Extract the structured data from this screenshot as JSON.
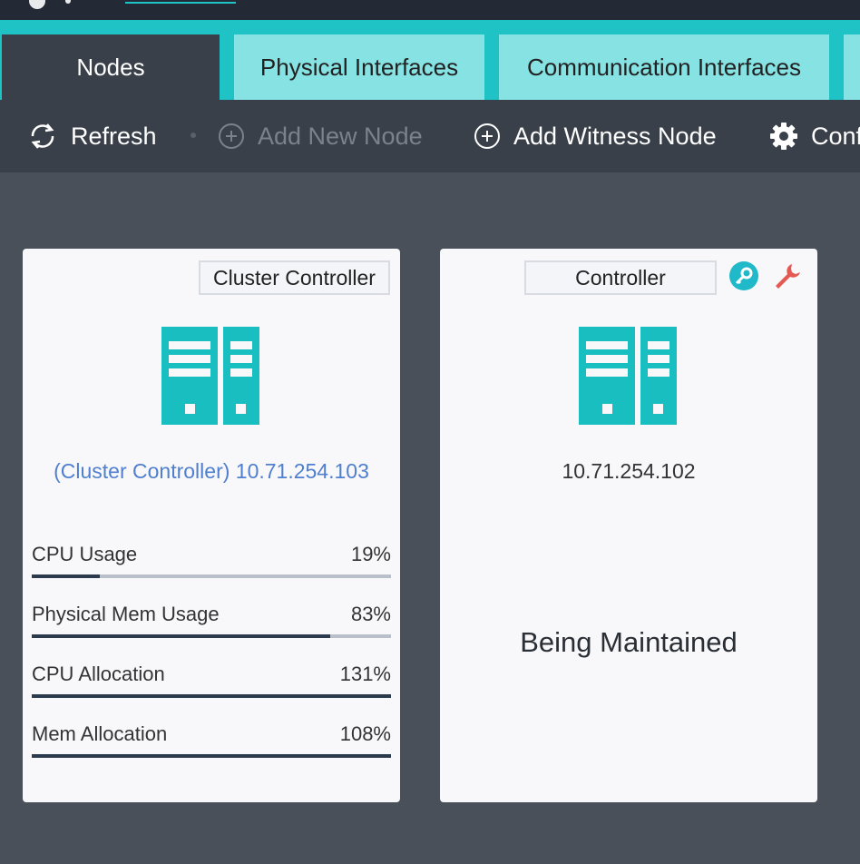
{
  "tabs": [
    {
      "label": "Nodes",
      "active": true
    },
    {
      "label": "Physical Interfaces",
      "active": false
    },
    {
      "label": "Communication Interfaces",
      "active": false
    }
  ],
  "toolbar": {
    "refresh": "Refresh",
    "add_new_node": "Add New Node",
    "add_witness_node": "Add Witness Node",
    "config_truncated": "Conf"
  },
  "colors": {
    "accent": "#1fc3c6",
    "server_icon": "#19bfc0",
    "link_blue": "#4f7fce",
    "wrench": "#e35a55"
  },
  "nodes": [
    {
      "role": "Cluster Controller",
      "ip_label": "(Cluster Controller) 10.71.254.103",
      "icon": "server-icon",
      "metrics": [
        {
          "label": "CPU Usage",
          "value": "19%",
          "fill_fraction": 0.19
        },
        {
          "label": "Physical Mem Usage",
          "value": "83%",
          "fill_fraction": 0.83
        },
        {
          "label": "CPU Allocation",
          "value": "131%",
          "fill_fraction": 1.0
        },
        {
          "label": "Mem Allocation",
          "value": "108%",
          "fill_fraction": 1.0
        }
      ]
    },
    {
      "role": "Controller",
      "ip_label": "10.71.254.102",
      "icon": "server-icon",
      "status": "Being Maintained",
      "action_icons": [
        "key-icon",
        "wrench-icon"
      ]
    }
  ]
}
